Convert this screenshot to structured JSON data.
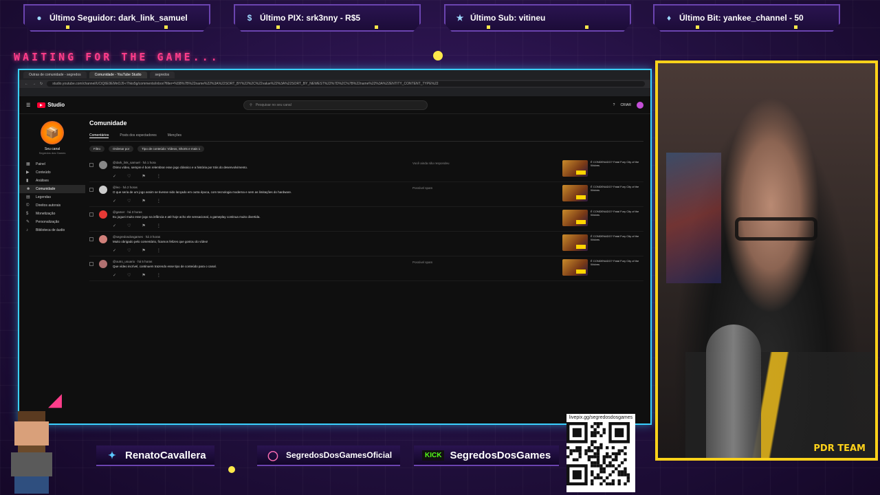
{
  "top_bars": [
    {
      "icon": "user-icon",
      "label": "Último Seguidor: dark_link_samuel"
    },
    {
      "icon": "dollar-icon",
      "label": "Último PIX: srk3nny - R$5"
    },
    {
      "icon": "star-icon",
      "label": "Último Sub: vitineu"
    },
    {
      "icon": "diamond-icon",
      "label": "Último Bit: yankee_channel - 50"
    }
  ],
  "waiting_text": "WAITING FOR THE GAME...",
  "browser": {
    "tabs": [
      "Outras de comunidade - segredos",
      "Comunidade - YouTube Studio",
      "segredos"
    ],
    "url": "studio.youtube.com/channel/UCtQ6E9EMnOJ9-r7hko5g/comments/inbox?filter=%5B%7B%22name%22%3A%22SORT_BY%22%2C%22value%22%3A%22SORT_BY_NEWEST%22%7D%2C%7B%22name%22%3A%22ENTITY_CONTENT_TYPE%22",
    "studio": {
      "logo_text": "Studio",
      "search_placeholder": "Pesquisar no seu canal",
      "header_right": [
        "?",
        "CRIAR"
      ],
      "channel_name": "Seu canal",
      "channel_sub": "Segredos dos Games",
      "nav": [
        {
          "icon": "dashboard-icon",
          "label": "Painel"
        },
        {
          "icon": "content-icon",
          "label": "Conteúdo"
        },
        {
          "icon": "analytics-icon",
          "label": "Análises"
        },
        {
          "icon": "community-icon",
          "label": "Comunidade",
          "active": true
        },
        {
          "icon": "subtitles-icon",
          "label": "Legendas"
        },
        {
          "icon": "copyright-icon",
          "label": "Direitos autorais"
        },
        {
          "icon": "monetization-icon",
          "label": "Monetização"
        },
        {
          "icon": "customization-icon",
          "label": "Personalização"
        },
        {
          "icon": "audio-library-icon",
          "label": "Biblioteca de áudio"
        }
      ],
      "page_title": "Comunidade",
      "page_tabs": [
        "Comentários",
        "Posts dos espectadores",
        "Menções"
      ],
      "filters": [
        "Filtro",
        "Ordenar por",
        "Tipo de conteúdo: Vídeos, Shorts e mais 1"
      ],
      "comments": [
        {
          "author": "@dark_link_samuel · há 1 hora",
          "text": "Ótimo vídeo, sempre é bom relembrar esse jogo clássico e a história por trás do desenvolvimento.",
          "status": "Você ainda não respondeu",
          "avatar_color": "#888888"
        },
        {
          "author": "@leo · há 2 horas",
          "text": "O que seria de um jogo assim se tivesse sido lançado em outra época, com tecnologia moderna e sem as limitações do hardware.",
          "status": "Possível spam",
          "avatar_color": "#cccccc"
        },
        {
          "author": "@gamer · há 3 horas",
          "text": "Eu joguei muito esse jogo na infância e até hoje acho ele sensacional, a gameplay continua muito divertida.",
          "status": "",
          "avatar_color": "#e53935"
        },
        {
          "author": "@segredosdosgames · há 3 horas",
          "text": "Muito obrigado pelo comentário, ficamos felizes que gostou do vídeo!",
          "status": "",
          "avatar_color": "#d0807a"
        },
        {
          "author": "@outro_usuario · há 5 horas",
          "text": "Que vídeo incrível, continuem trazendo esse tipo de conteúdo para o canal.",
          "status": "Possível spam",
          "avatar_color": "#b07070"
        }
      ],
      "video_title": "É CONDENADO? Fatal Fury City of the Wolves"
    }
  },
  "social": [
    {
      "icon": "twitter-icon",
      "label": "RenatoCavallera"
    },
    {
      "icon": "instagram-icon",
      "label": "SegredosDosGamesOficial"
    },
    {
      "icon": "kick-icon",
      "badge": "KICK",
      "label": "SegredosDosGames"
    }
  ],
  "qr_url": "livepix.gg/segredosdosgames",
  "cam_brand": "PDR TEAM",
  "colors": {
    "accent": "#3bd1ff",
    "frame": "#ffd21a",
    "purple": "#6b44b0"
  }
}
